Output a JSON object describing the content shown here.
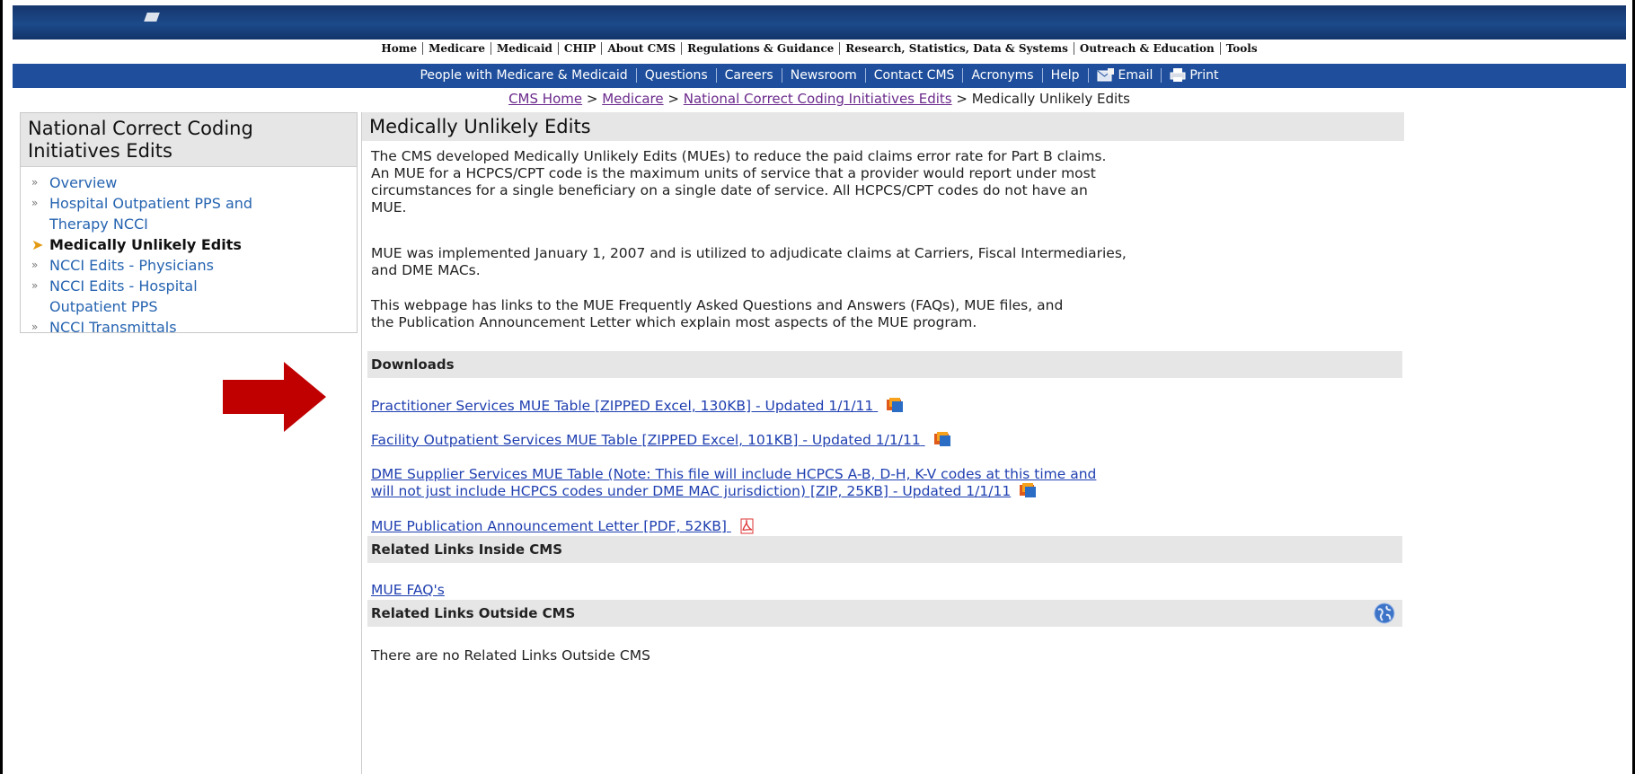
{
  "top_nav": [
    "Home",
    "Medicare",
    "Medicaid",
    "CHIP",
    "About CMS",
    "Regulations & Guidance",
    "Research, Statistics, Data & Systems",
    "Outreach & Education",
    "Tools"
  ],
  "sub_nav": {
    "items": [
      "People with Medicare & Medicaid",
      "Questions",
      "Careers",
      "Newsroom",
      "Contact CMS",
      "Acronyms",
      "Help"
    ],
    "email": "Email",
    "print": "Print"
  },
  "breadcrumb": {
    "links": [
      "CMS Home",
      "Medicare",
      "National Correct Coding Initiatives Edits"
    ],
    "separator": ">",
    "current": "Medically Unlikely Edits"
  },
  "sidebar": {
    "title_line1": "National Correct Coding",
    "title_line2": "Initiatives Edits",
    "items": [
      {
        "label": "Overview",
        "active": false
      },
      {
        "label": "Hospital Outpatient PPS and",
        "label2": "Therapy NCCI",
        "active": false
      },
      {
        "label": "Medically Unlikely Edits",
        "active": true
      },
      {
        "label": "NCCI Edits - Physicians",
        "active": false
      },
      {
        "label": "NCCI Edits - Hospital",
        "label2": "Outpatient PPS",
        "active": false
      },
      {
        "label": "NCCI Transmittals",
        "active": false
      }
    ]
  },
  "main": {
    "title": "Medically Unlikely Edits",
    "p1": [
      "The CMS developed Medically Unlikely Edits (MUEs) to reduce the paid claims error rate for Part B claims.",
      "An MUE for a HCPCS/CPT code is the maximum units of service that a provider would report under most",
      "circumstances for a single beneficiary on a single date of service.  All HCPCS/CPT codes do not have an",
      "MUE."
    ],
    "p2": [
      "MUE was implemented January 1, 2007 and is utilized to adjudicate claims at Carriers, Fiscal Intermediaries,",
      "and DME MACs."
    ],
    "p3": [
      "This webpage has links to the MUE Frequently Asked Questions and Answers (FAQs), MUE files, and",
      "the Publication Announcement Letter which explain most aspects of the MUE program."
    ],
    "downloads_heading": "Downloads",
    "downloads": [
      "Practitioner Services MUE Table [ZIPPED Excel, 130KB] - Updated 1/1/11",
      "Facility Outpatient Services MUE Table [ZIPPED Excel, 101KB] - Updated 1/1/11",
      "DME Supplier Services MUE Table  (Note: This file will include HCPCS A-B, D-H, K-V codes at this time and",
      "will not just include HCPCS codes under DME MAC jurisdiction) [ZIP, 25KB] - Updated 1/1/11",
      "MUE Publication Announcement Letter [PDF, 52KB]"
    ],
    "related_inside_heading": "Related Links Inside CMS",
    "related_inside_link": "MUE FAQ's",
    "related_outside_heading": "Related Links Outside CMS",
    "related_outside_text": "There are no Related Links Outside CMS"
  },
  "colors": {
    "banner": "#16366d",
    "subnav": "#1f4f9c",
    "link": "#1f3fb0",
    "visited": "#6b2a8c",
    "arrow": "#c00000",
    "section_bg": "#e6e6e6"
  }
}
